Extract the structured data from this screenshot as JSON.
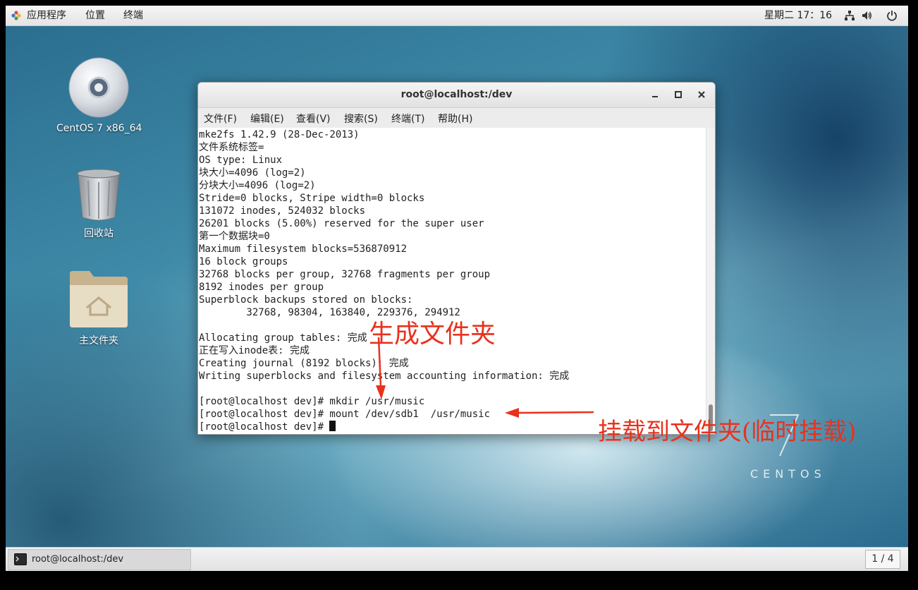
{
  "topbar": {
    "applications": "应用程序",
    "places": "位置",
    "terminal": "终端",
    "clock": "星期二 17：16",
    "icons": [
      "network-icon",
      "volume-icon",
      "power-icon"
    ]
  },
  "desktop": {
    "icons": [
      {
        "label": "CentOS 7 x86_64",
        "icon": "disc-icon"
      },
      {
        "label": "回收站",
        "icon": "trash-icon"
      },
      {
        "label": "主文件夹",
        "icon": "home-folder-icon"
      }
    ],
    "watermark": "CENTOS"
  },
  "window": {
    "title": "root@localhost:/dev",
    "menu": [
      "文件(F)",
      "编辑(E)",
      "查看(V)",
      "搜索(S)",
      "终端(T)",
      "帮助(H)"
    ],
    "terminal_text": "mke2fs 1.42.9 (28-Dec-2013)\n文件系统标签=\nOS type: Linux\n块大小=4096 (log=2)\n分块大小=4096 (log=2)\nStride=0 blocks, Stripe width=0 blocks\n131072 inodes, 524032 blocks\n26201 blocks (5.00%) reserved for the super user\n第一个数据块=0\nMaximum filesystem blocks=536870912\n16 block groups\n32768 blocks per group, 32768 fragments per group\n8192 inodes per group\nSuperblock backups stored on blocks:\n        32768, 98304, 163840, 229376, 294912\n\nAllocating group tables: 完成\n正在写入inode表: 完成\nCreating journal (8192 blocks): 完成\nWriting superblocks and filesystem accounting information: 完成\n\n[root@localhost dev]# mkdir /usr/music\n[root@localhost dev]# mount /dev/sdb1  /usr/music\n[root@localhost dev]# "
  },
  "annotations": {
    "mkdir_note": "生成文件夹",
    "mount_note": "挂载到文件夹(临时挂载)",
    "color": "#e8321e"
  },
  "taskbar": {
    "task_label": "root@localhost:/dev",
    "pager": "1 / 4"
  }
}
